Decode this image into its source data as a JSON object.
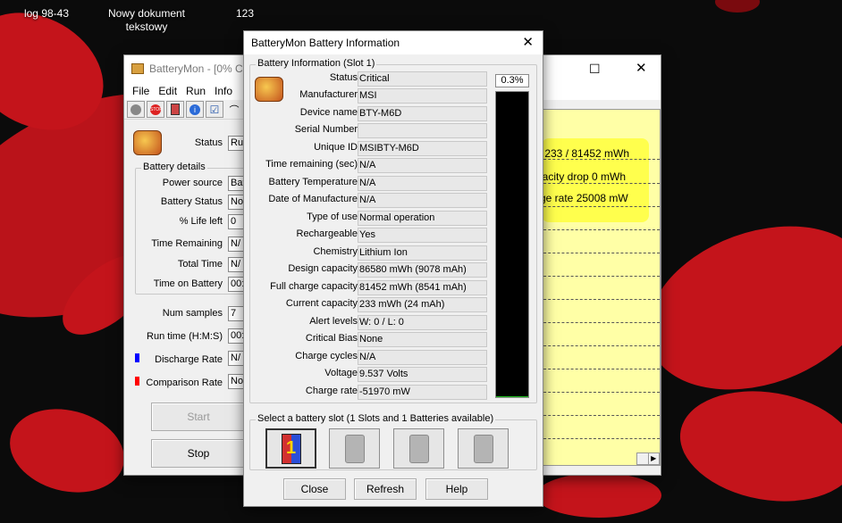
{
  "desktop": {
    "icons": [
      {
        "label": "log 98-43"
      },
      {
        "label": "Nowy dokument tekstowy"
      },
      {
        "label": "123"
      }
    ]
  },
  "main_window": {
    "title": "BatteryMon - [0% C",
    "menu": [
      "File",
      "Edit",
      "Run",
      "Info"
    ],
    "status_label": "Status",
    "status_value": "Ru",
    "battery_details_title": "Battery details",
    "details": [
      {
        "label": "Power source",
        "value": "Bat"
      },
      {
        "label": "Battery Status",
        "value": "No"
      },
      {
        "label": "% Life left",
        "value": "0"
      },
      {
        "label": "Time Remaining",
        "value": "N/"
      },
      {
        "label": "Total Time",
        "value": "N/"
      },
      {
        "label": "Time on Battery",
        "value": "00:"
      }
    ],
    "num_samples_label": "Num samples",
    "num_samples_value": "7",
    "run_time_label": "Run time (H:M:S)",
    "run_time_value": "00:",
    "discharge_label": "Discharge Rate",
    "discharge_value": "N/",
    "comparison_label": "Comparison Rate",
    "comparison_value": "No",
    "start_label": "Start",
    "stop_label": "Stop",
    "graph_lines": [
      "y 233 / 81452 mWh",
      "pacity drop 0 mWh",
      "rge rate 25008 mW"
    ],
    "colors": {
      "discharge": "#0000ff",
      "comparison": "#ff0000",
      "graph_bg": "#ffffa6"
    }
  },
  "dialog": {
    "title": "BatteryMon Battery Information",
    "group_title": "Battery Information (Slot 1)",
    "fields": [
      {
        "label": "Status",
        "value": "Critical"
      },
      {
        "label": "Manufacturer",
        "value": "MSI"
      },
      {
        "label": "Device name",
        "value": "BTY-M6D"
      },
      {
        "label": "Serial Number",
        "value": ""
      },
      {
        "label": "Unique ID",
        "value": "MSIBTY-M6D"
      },
      {
        "label": "Time remaining (sec)",
        "value": "N/A"
      },
      {
        "label": "Battery Temperature",
        "value": "N/A"
      },
      {
        "label": "Date of Manufacture",
        "value": "N/A"
      },
      {
        "label": "Type of use",
        "value": "Normal operation"
      },
      {
        "label": "Rechargeable",
        "value": "Yes"
      },
      {
        "label": "Chemistry",
        "value": "Lithium Ion"
      },
      {
        "label": "Design capacity",
        "value": "86580 mWh (9078 mAh)"
      },
      {
        "label": "Full charge capacity",
        "value": "81452 mWh (8541 mAh)"
      },
      {
        "label": "Current capacity",
        "value": "233 mWh (24 mAh)"
      },
      {
        "label": "Alert levels",
        "value": "W: 0 / L: 0"
      },
      {
        "label": "Critical Bias",
        "value": "None"
      },
      {
        "label": "Charge cycles",
        "value": "N/A"
      },
      {
        "label": "Voltage",
        "value": "9.537 Volts"
      },
      {
        "label": "Charge rate",
        "value": "-51970 mW"
      }
    ],
    "charge_percent_text": "0.3%",
    "charge_fraction": 0.003,
    "slot_group_title": "Select a battery slot (1 Slots and 1 Batteries available)",
    "selected_slot_number": "1",
    "close_label": "Close",
    "refresh_label": "Refresh",
    "help_label": "Help"
  }
}
